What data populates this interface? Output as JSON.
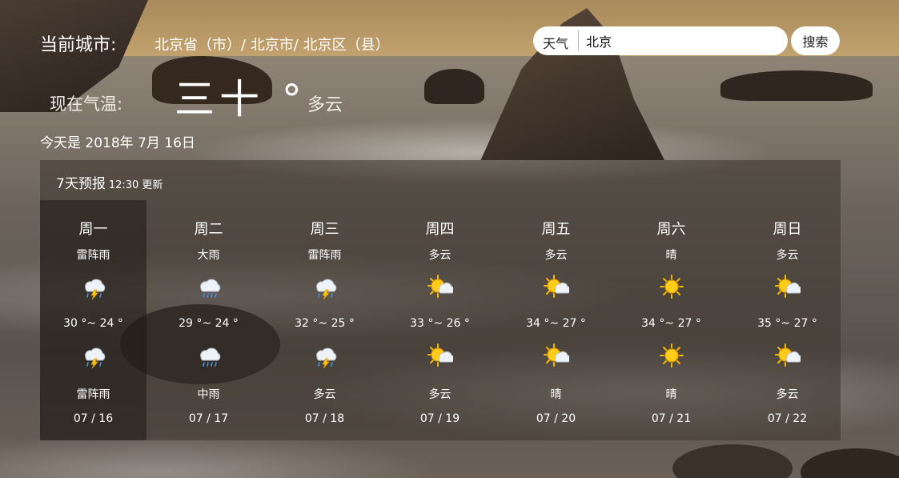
{
  "header": {
    "city_label": "当前城市:",
    "city_path": "北京省（市）/ 北京市/ 北京区（县）",
    "search_prefix": "天气",
    "search_value": "北京",
    "search_button": "搜索"
  },
  "current": {
    "temp_label": "现在气温:",
    "temp_value": "三十 °",
    "condition": "多云",
    "date_line": "今天是 2018年 7月 16日"
  },
  "forecast": {
    "title": "7天预报",
    "updated": "12:30 更新",
    "days": [
      {
        "name": "周一",
        "weather_day": "雷阵雨",
        "icon_day": "thunderstorm-icon",
        "temp_range": "30 °~ 24 °",
        "icon_night": "thunderstorm-icon",
        "weather_night": "雷阵雨",
        "date": "07 / 16"
      },
      {
        "name": "周二",
        "weather_day": "大雨",
        "icon_day": "rain-icon",
        "temp_range": "29 °~ 24 °",
        "icon_night": "rain-icon",
        "weather_night": "中雨",
        "date": "07 / 17"
      },
      {
        "name": "周三",
        "weather_day": "雷阵雨",
        "icon_day": "thunderstorm-icon",
        "temp_range": "32 °~ 25 °",
        "icon_night": "thunderstorm-icon",
        "weather_night": "多云",
        "date": "07 / 18"
      },
      {
        "name": "周四",
        "weather_day": "多云",
        "icon_day": "partly-cloudy-icon",
        "temp_range": "33 °~ 26 °",
        "icon_night": "partly-cloudy-icon",
        "weather_night": "多云",
        "date": "07 / 19"
      },
      {
        "name": "周五",
        "weather_day": "多云",
        "icon_day": "partly-cloudy-icon",
        "temp_range": "34 °~ 27 °",
        "icon_night": "partly-cloudy-icon",
        "weather_night": "晴",
        "date": "07 / 20"
      },
      {
        "name": "周六",
        "weather_day": "晴",
        "icon_day": "sun-icon",
        "temp_range": "34 °~ 27 °",
        "icon_night": "sun-icon",
        "weather_night": "晴",
        "date": "07 / 21"
      },
      {
        "name": "周日",
        "weather_day": "多云",
        "icon_day": "partly-cloudy-icon",
        "temp_range": "35 °~ 27 °",
        "icon_night": "partly-cloudy-icon",
        "weather_night": "多云",
        "date": "07 / 22"
      }
    ]
  },
  "colors": {
    "panel_bg": "#3c342e",
    "active_day_bg": "#1e1916",
    "sun": "#f5b800",
    "cloud": "#e8eef5"
  }
}
